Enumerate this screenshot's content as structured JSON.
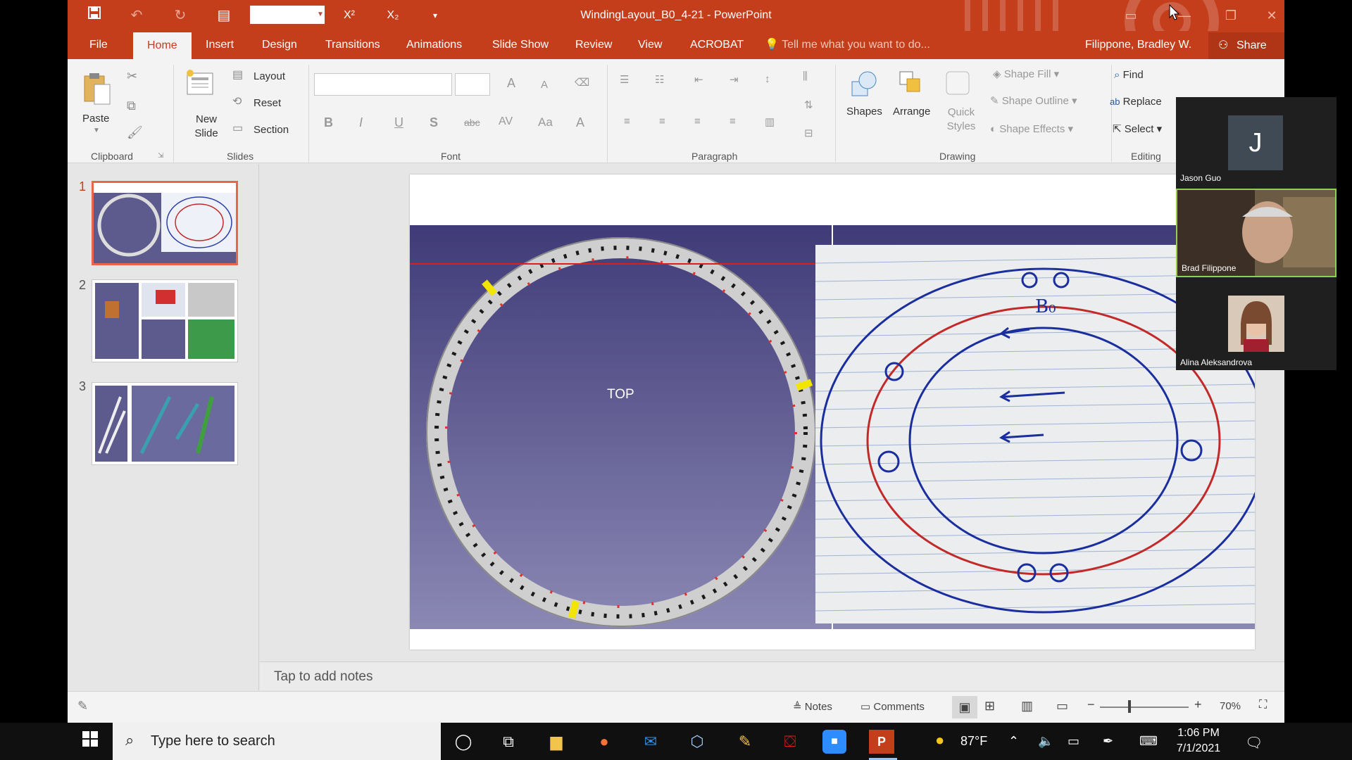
{
  "window": {
    "title": "WindingLayout_B0_4-21 - PowerPoint",
    "user": "Filippone, Bradley W.",
    "share": "Share",
    "accent": "#c43e1c"
  },
  "quick_access": {
    "icons": [
      "save-icon",
      "undo-icon",
      "redo-icon",
      "presentation-icon",
      "superscript-icon",
      "subscript-icon",
      "customize-icon"
    ],
    "superscript_label": "X²",
    "subscript_label": "X₂"
  },
  "tabs": [
    "File",
    "Home",
    "Insert",
    "Design",
    "Transitions",
    "Animations",
    "Slide Show",
    "Review",
    "View",
    "ACROBAT"
  ],
  "active_tab": "Home",
  "tell_me": "Tell me what you want to do...",
  "ribbon": {
    "clipboard": {
      "label": "Clipboard",
      "paste": "Paste"
    },
    "slides": {
      "label": "Slides",
      "new_slide": "New Slide",
      "layout": "Layout",
      "reset": "Reset",
      "section": "Section"
    },
    "font": {
      "label": "Font",
      "bold": "B",
      "italic": "I",
      "underline": "U",
      "shadow": "S",
      "strike": "abc",
      "spacing": "AV",
      "case": "Aa",
      "color": "A",
      "grow": "A",
      "shrink": "A"
    },
    "paragraph": {
      "label": "Paragraph"
    },
    "drawing": {
      "label": "Drawing",
      "shapes": "Shapes",
      "arrange": "Arrange",
      "quick_styles": "Quick Styles",
      "shape_fill": "Shape Fill",
      "shape_outline": "Shape Outline",
      "shape_effects": "Shape Effects"
    },
    "editing": {
      "label": "Editing",
      "find": "Find",
      "replace": "Replace",
      "select": "Select"
    }
  },
  "slides": [
    {
      "number": "1",
      "selected": true
    },
    {
      "number": "2",
      "selected": false
    },
    {
      "number": "3",
      "selected": false
    }
  ],
  "current_slide": {
    "center_label": "TOP",
    "left_bg": "#5d5a8e",
    "ring_color": "#d9d9d9",
    "sketch_ink": "#1a2e9e",
    "sketch_red": "#c22a2a",
    "sketch_label": "B₀"
  },
  "notes_placeholder": "Tap to add notes",
  "status": {
    "notes": "Notes",
    "comments": "Comments",
    "zoom": "70%",
    "zoom_level": 0.7
  },
  "participants": [
    {
      "name": "Jason Guo",
      "initial": "J"
    },
    {
      "name": "Brad Filippone"
    },
    {
      "name": "Alina Aleksandrova"
    }
  ],
  "taskbar": {
    "search_placeholder": "Type here to search",
    "weather": "87°F",
    "time": "1:06 PM",
    "date": "7/1/2021",
    "apps": [
      "cortana-icon",
      "task-view-icon",
      "file-explorer-icon",
      "firefox-icon",
      "mail-icon",
      "3d-viewer-icon",
      "paint-icon",
      "acrobat-icon",
      "zoom-icon",
      "powerpoint-icon"
    ]
  }
}
